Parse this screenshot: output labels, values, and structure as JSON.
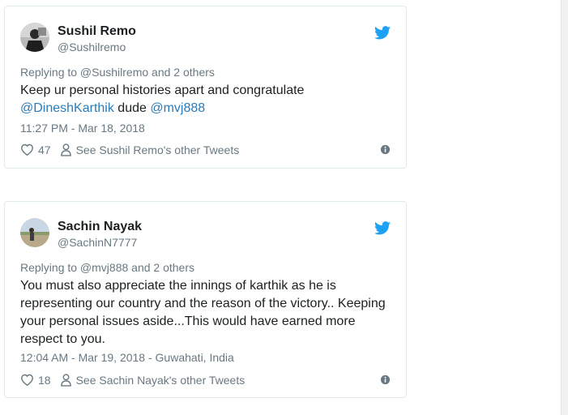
{
  "tweets": [
    {
      "name": "Sushil Remo",
      "handle": "@Sushilremo",
      "replying": "Replying to @Sushilremo and 2 others",
      "text_part1": "Keep ur personal histories apart and congratulate",
      "mention1": "@DineshKarthik",
      "text_part2": " dude ",
      "mention2": "@mvj888",
      "timestamp": "11:27 PM - Mar 18, 2018",
      "likes": "47",
      "see_other": "See Sushil Remo's other Tweets",
      "icons": [
        "avatar-photo",
        "twitter-bird-icon",
        "heart-icon",
        "person-icon",
        "info-icon"
      ]
    },
    {
      "name": "Sachin Nayak",
      "handle": "@SachinN7777",
      "replying": "Replying to @mvj888 and 2 others",
      "text_line1": "You must also appreciate the innings of karthik as he is",
      "text_line2": "representing our country and the reason of the victory.. Keeping",
      "text_line3": "your personal issues aside...This would have earned more",
      "text_line4": "respect to you.",
      "timestamp": "12:04 AM - Mar 19, 2018 - Guwahati, India",
      "likes": "18",
      "see_other": "See Sachin Nayak's other Tweets",
      "icons": [
        "avatar-photo",
        "twitter-bird-icon",
        "heart-icon",
        "person-icon",
        "info-icon"
      ]
    }
  ],
  "colors": {
    "link": "#2b7bb9",
    "muted": "#697882",
    "text": "#1c2022",
    "twitter_blue": "#1da1f2",
    "border": "#e1e8ed"
  }
}
